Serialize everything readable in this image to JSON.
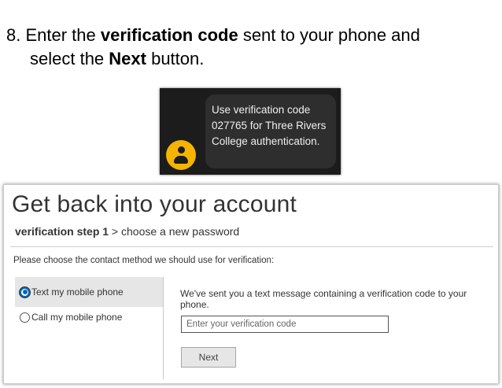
{
  "instruction": {
    "step_prefix": "8. Enter the ",
    "bold_1": "verification code",
    "middle": " sent to your phone and",
    "line2_prefix": "select the ",
    "bold_2": "Next",
    "suffix": " button."
  },
  "sms_notification": {
    "message": "Use verification code 027765 for Three Rivers College authentication.",
    "avatar_icon": "person-icon",
    "avatar_color": "#f4b400"
  },
  "recovery": {
    "title": "Get back into your account",
    "step_current": "verification step 1",
    "step_next": " > choose a new password",
    "prompt": "Please choose the contact method we should use for verification:",
    "methods": [
      {
        "label": "Text my mobile phone",
        "selected": true
      },
      {
        "label": "Call my mobile phone",
        "selected": false
      }
    ],
    "sent_message": "We've sent you a text message containing a verification code to your phone.",
    "code_placeholder": "Enter your verification code",
    "next_label": "Next",
    "accent_color": "#0067b8"
  }
}
